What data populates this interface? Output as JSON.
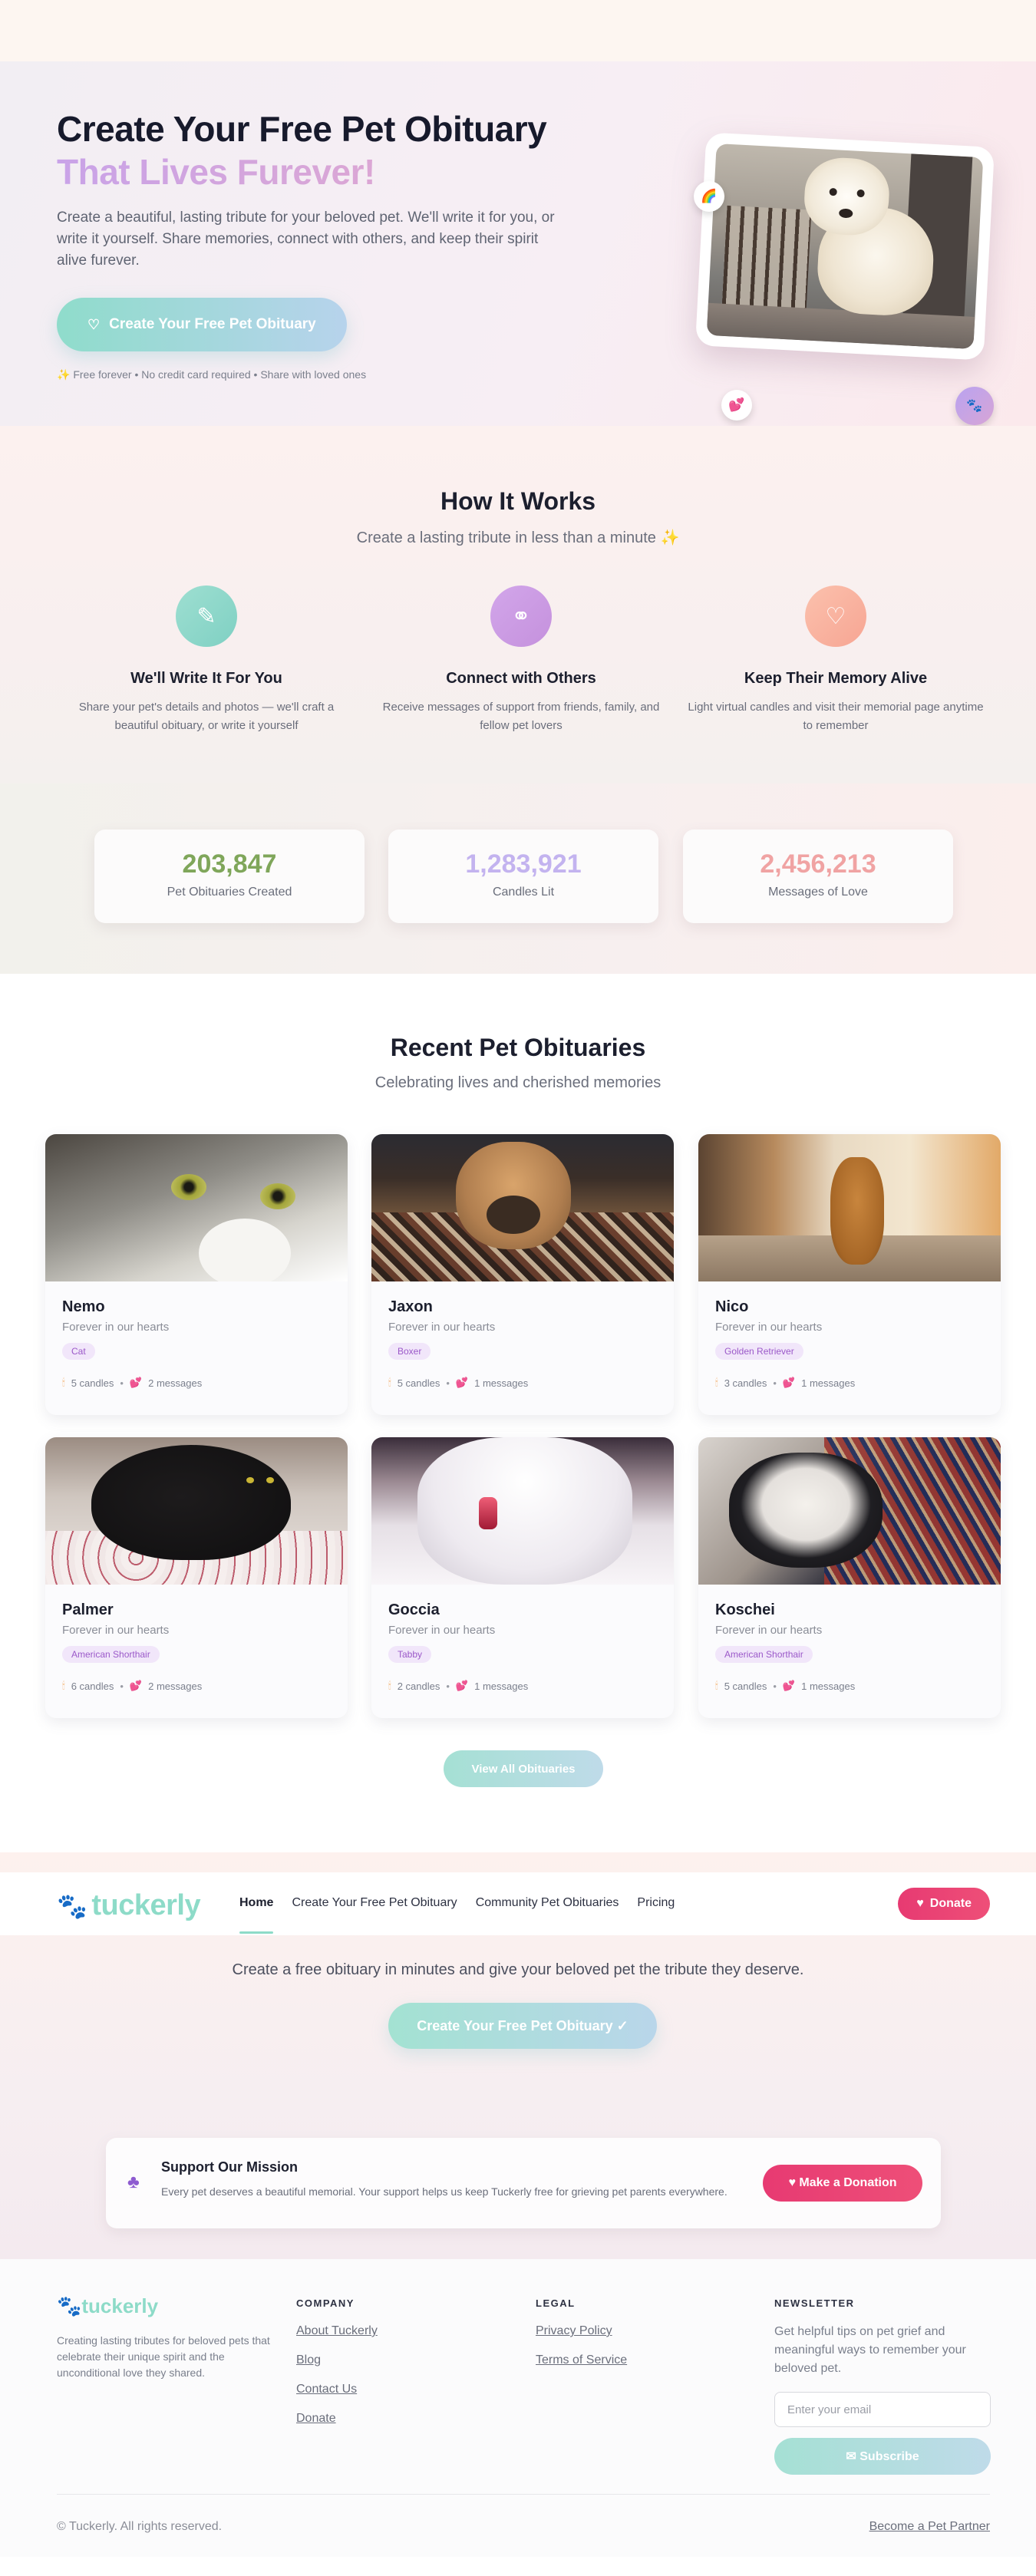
{
  "hero": {
    "title": "Create Your Free Pet Obituary",
    "subtitle": "That Lives Furever!",
    "description": "Create a beautiful, lasting tribute for your beloved pet. We'll write it for you, or write it yourself. Share memories, connect with others, and keep their spirit alive furever.",
    "cta_label": "Create Your Free Pet Obituary",
    "note": "Free forever • No credit card required • Share with loved ones",
    "colors": {
      "accent_teal": "#8fdccb",
      "accent_purple": "#c9a3e8",
      "brand_pink": "#e73a72"
    }
  },
  "how_it_works": {
    "title": "How It Works",
    "subtitle": "Create a lasting tribute in less than a minute",
    "items": [
      {
        "icon": "pencil-icon",
        "title": "We'll Write It For You",
        "description": "Share your pet's details and photos — we'll craft a beautiful obituary, or write it yourself"
      },
      {
        "icon": "users-icon",
        "title": "Connect with Others",
        "description": "Receive messages of support from friends, family, and fellow pet lovers"
      },
      {
        "icon": "heart-icon",
        "title": "Keep Their Memory Alive",
        "description": "Light virtual candles and visit their memorial page anytime to remember"
      }
    ]
  },
  "stats": [
    {
      "value": "203,847",
      "label": "Pet Obituaries Created",
      "color": "#7fa65a"
    },
    {
      "value": "1,283,921",
      "label": "Candles Lit",
      "color": "#c3b3ef"
    },
    {
      "value": "2,456,213",
      "label": "Messages of Love",
      "color": "#f0a3a3"
    }
  ],
  "recent": {
    "title": "Recent Pet Obituaries",
    "subtitle": "Celebrating lives and cherished memories",
    "cards": [
      {
        "name": "Nemo",
        "subtitle": "Forever in our hearts",
        "breed": "Cat",
        "candles": "5 candles",
        "messages": "2 messages"
      },
      {
        "name": "Jaxon",
        "subtitle": "Forever in our hearts",
        "breed": "Boxer",
        "candles": "5 candles",
        "messages": "1 messages"
      },
      {
        "name": "Nico",
        "subtitle": "Forever in our hearts",
        "breed": "Golden Retriever",
        "candles": "3 candles",
        "messages": "1 messages"
      },
      {
        "name": "Palmer",
        "subtitle": "Forever in our hearts",
        "breed": "American Shorthair",
        "candles": "6 candles",
        "messages": "2 messages"
      },
      {
        "name": "Goccia",
        "subtitle": "Forever in our hearts",
        "breed": "Tabby",
        "candles": "2 candles",
        "messages": "1 messages"
      },
      {
        "name": "Koschei",
        "subtitle": "Forever in our hearts",
        "breed": "American Shorthair",
        "candles": "5 candles",
        "messages": "1 messages"
      }
    ],
    "view_all_label": "View All Obituaries"
  },
  "nav": {
    "logo": "tuckerly",
    "links": [
      "Home",
      "Create Your Free Pet Obituary",
      "Community Pet Obituaries",
      "Pricing"
    ],
    "donate_label": "Donate"
  },
  "cta": {
    "text": "Create a free obituary in minutes and give your beloved pet the tribute they deserve.",
    "button_label": "Create Your Free Pet Obituary ✓"
  },
  "mission": {
    "title": "Support Our Mission",
    "description": "Every pet deserves a beautiful memorial. Your support helps us keep Tuckerly free for grieving pet parents everywhere.",
    "button_label": "Make a Donation"
  },
  "footer": {
    "logo": "tuckerly",
    "tagline": "Creating lasting tributes for beloved pets that celebrate their unique spirit and the unconditional love they shared.",
    "company_heading": "COMPANY",
    "company_links": [
      "About Tuckerly",
      "Blog",
      "Contact Us",
      "Donate"
    ],
    "legal_heading": "LEGAL",
    "legal_links": [
      "Privacy Policy",
      "Terms of Service"
    ],
    "newsletter_heading": "NEWSLETTER",
    "newsletter_desc": "Get helpful tips on pet grief and meaningful ways to remember your beloved pet.",
    "email_placeholder": "Enter your email",
    "subscribe_label": "Subscribe",
    "copyright": "© Tuckerly. All rights reserved.",
    "partner_link": "Become a Pet Partner"
  }
}
